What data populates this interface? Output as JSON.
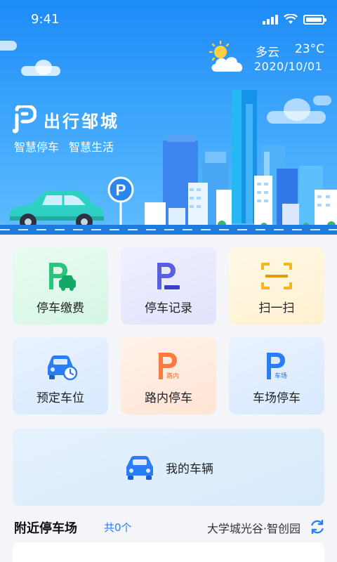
{
  "status_bar": {
    "time": "9:41"
  },
  "weather": {
    "condition": "多云",
    "temperature": "23°C",
    "date": "2020/10/01"
  },
  "brand": {
    "title": "出行邹城",
    "slogan_1": "智慧停车",
    "slogan_2": "智慧生活"
  },
  "parking_sign": {
    "letter": "P"
  },
  "services": [
    {
      "label": "停车缴费",
      "icon": "parking-payment-icon"
    },
    {
      "label": "停车记录",
      "icon": "parking-record-icon"
    },
    {
      "label": "扫一扫",
      "icon": "scan-icon"
    },
    {
      "label": "预定车位",
      "icon": "reserve-space-icon"
    },
    {
      "label": "路内停车",
      "icon": "street-parking-icon",
      "badge": "路内"
    },
    {
      "label": "车场停车",
      "icon": "lot-parking-icon",
      "badge": "车场"
    }
  ],
  "my_vehicle": {
    "label": "我的车辆",
    "icon": "car-icon"
  },
  "nearby": {
    "title": "附近停车场",
    "count": "共0个",
    "location": "大学城光谷·智创园",
    "icon": "refresh-icon"
  },
  "colors": {
    "primary": "#2a7df4",
    "hero_top": "#1d8bf7",
    "green": "#2bc47d",
    "purple": "#5a5fe0",
    "yellow": "#f4b51e",
    "orange": "#ff7a3d"
  }
}
